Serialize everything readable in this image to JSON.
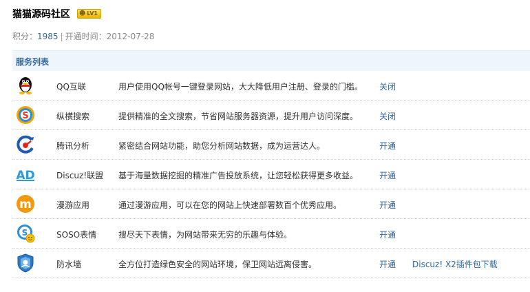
{
  "header": {
    "title": "猫猫源码社区",
    "level_badge": "LV1"
  },
  "meta": {
    "points_label": "积分：",
    "points": "1985",
    "sep": "|",
    "open_time_label": "开通时间：",
    "open_time": "2012-07-28"
  },
  "panel": {
    "title": "服务列表"
  },
  "services": [
    {
      "name": "QQ互联",
      "desc": "用户使用QQ帐号一键登录网站，大大降低用户注册、登录的门槛。",
      "action": "关闭",
      "icon": "qq-penguin-icon"
    },
    {
      "name": "纵横搜索",
      "desc": "提供精准的全文搜索，节省网站服务器资源，提升用户访问深度。",
      "action": "关闭",
      "icon": "soso-search-icon"
    },
    {
      "name": "腾讯分析",
      "desc": "紧密结合网站功能，助您分析网站数据，成为运营达人。",
      "action": "开通",
      "icon": "tencent-analytics-icon"
    },
    {
      "name": "Discuz!联盟",
      "desc": "基于海量数据挖掘的精准广告投放系统，让您轻松获得更多收益。",
      "action": "开通",
      "icon": "ad-union-icon"
    },
    {
      "name": "漫游应用",
      "desc": "通过漫游应用，可以在您的网站上快速部署数百个优秀应用。",
      "action": "开通",
      "icon": "manyou-app-icon"
    },
    {
      "name": "SOSO表情",
      "desc": "搜尽天下表情，为网站带来无穷的乐趣与体验。",
      "action": "开通",
      "icon": "soso-emoticon-icon"
    },
    {
      "name": "防水墙",
      "desc": "全方位打造绿色安全的网站环境，保卫网站远离侵害。",
      "action": "开通",
      "icon": "firewall-shield-icon",
      "sep": "|",
      "extra": "Discuz! X2插件包下载"
    }
  ],
  "colors": {
    "link": "#336699",
    "panel_bg": "#eef6fc"
  }
}
